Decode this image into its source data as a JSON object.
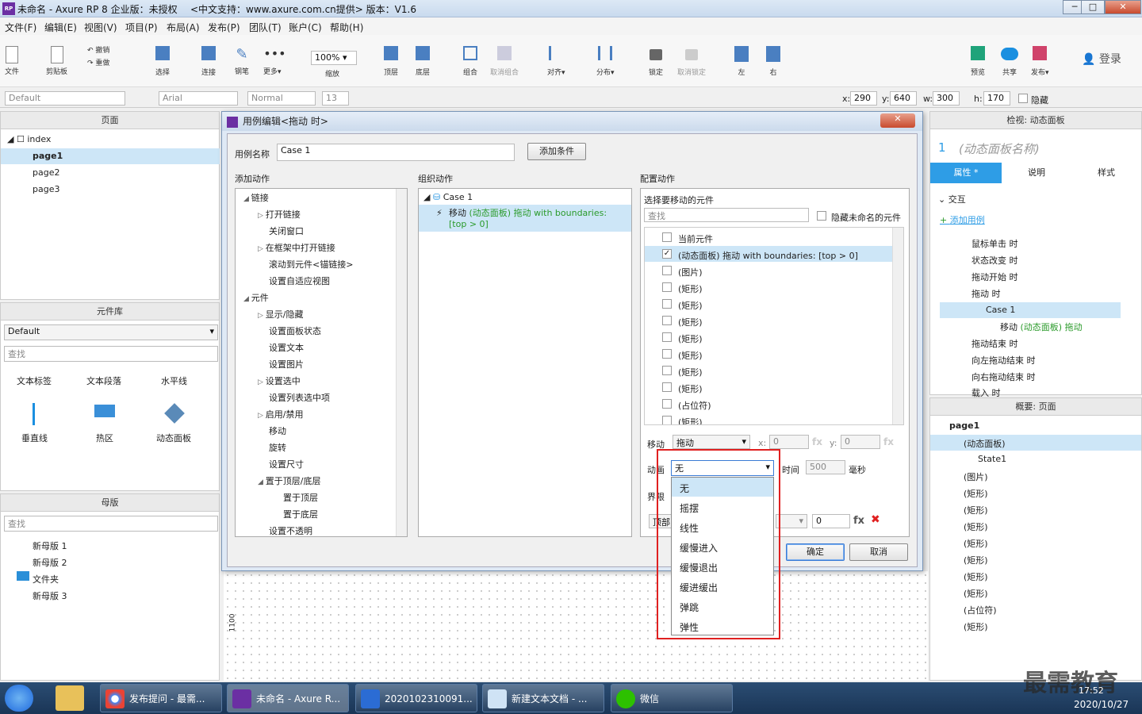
{
  "window": {
    "title": "未命名 - Axure RP 8 企业版：未授权",
    "support": "<中文支持：www.axure.com.cn提供> 版本：V1.6",
    "min": "─",
    "max": "□",
    "close": "✕"
  },
  "menu": [
    "文件(F)",
    "编辑(E)",
    "视图(V)",
    "项目(P)",
    "布局(A)",
    "发布(P)",
    "团队(T)",
    "账户(C)",
    "帮助(H)"
  ],
  "toolbar": {
    "file": "文件",
    "clipboard": "剪贴板",
    "undo": "撤销",
    "redo": "重做",
    "select": "选择",
    "connect": "连接",
    "pen": "钢笔",
    "more": "更多▾",
    "zoom": "100%",
    "zoom_label": "缩放",
    "top": "顶层",
    "bottom": "底层",
    "group": "组合",
    "ungroup": "取消组合",
    "align": "对齐▾",
    "distribute": "分布▾",
    "lock": "锁定",
    "unlock": "取消锁定",
    "left": "左",
    "right": "右",
    "preview": "预览",
    "share": "共享",
    "publish": "发布▾",
    "login": "登录"
  },
  "format": {
    "style": "Default",
    "font": "Arial",
    "weight": "Normal",
    "size": "13",
    "x_label": "x:",
    "x": "290",
    "y_label": "y:",
    "y": "640",
    "w_label": "w:",
    "w": "300",
    "h_label": "h:",
    "h": "170",
    "hidden": "隐藏"
  },
  "pages": {
    "title": "页面",
    "items": [
      "index",
      "page1",
      "page2",
      "page3"
    ]
  },
  "library": {
    "title": "元件库",
    "select": "Default",
    "search_placeholder": "查找",
    "widgets": [
      "文本标签",
      "文本段落",
      "水平线",
      "垂直线",
      "热区",
      "动态面板"
    ]
  },
  "masters": {
    "title": "母版",
    "search_placeholder": "查找",
    "items": [
      "新母版 1",
      "新母版 2",
      "文件夹",
      "新母版 3"
    ]
  },
  "dialog": {
    "title": "用例编辑<拖动 时>",
    "case_name_label": "用例名称",
    "case_name": "Case 1",
    "add_condition": "添加条件",
    "add_action": "添加动作",
    "organize": "组织动作",
    "configure": "配置动作",
    "actions": [
      {
        "t": "链接",
        "lvl": 0,
        "exp": "open"
      },
      {
        "t": "打开链接",
        "lvl": 1,
        "exp": "closed"
      },
      {
        "t": "关闭窗口",
        "lvl": 1
      },
      {
        "t": "在框架中打开链接",
        "lvl": 1,
        "exp": "closed"
      },
      {
        "t": "滚动到元件<锚链接>",
        "lvl": 1
      },
      {
        "t": "设置自适应视图",
        "lvl": 1
      },
      {
        "t": "元件",
        "lvl": 0,
        "exp": "open"
      },
      {
        "t": "显示/隐藏",
        "lvl": 1,
        "exp": "closed"
      },
      {
        "t": "设置面板状态",
        "lvl": 1
      },
      {
        "t": "设置文本",
        "lvl": 1
      },
      {
        "t": "设置图片",
        "lvl": 1
      },
      {
        "t": "设置选中",
        "lvl": 1,
        "exp": "closed"
      },
      {
        "t": "设置列表选中项",
        "lvl": 1
      },
      {
        "t": "启用/禁用",
        "lvl": 1,
        "exp": "closed"
      },
      {
        "t": "移动",
        "lvl": 1
      },
      {
        "t": "旋转",
        "lvl": 1
      },
      {
        "t": "设置尺寸",
        "lvl": 1
      },
      {
        "t": "置于顶层/底层",
        "lvl": 1,
        "exp": "open"
      },
      {
        "t": "置于顶层",
        "lvl": 2
      },
      {
        "t": "置于底层",
        "lvl": 2
      },
      {
        "t": "设置不透明",
        "lvl": 1
      }
    ],
    "org_case": "Case 1",
    "org_action": {
      "pre": "移动 ",
      "green": "(动态面板) 拖动 with boundaries:",
      "line2": "[top > 0]"
    },
    "select_widget": "选择要移动的元件",
    "filter_placeholder": "查找",
    "hide_unnamed": "隐藏未命名的元件",
    "widgets": [
      {
        "t": "当前元件",
        "checked": false
      },
      {
        "t": "(动态面板) 拖动 with boundaries: [top > 0]",
        "checked": true
      },
      {
        "t": "(图片)",
        "checked": false
      },
      {
        "t": "(矩形)",
        "checked": false
      },
      {
        "t": "(矩形)",
        "checked": false
      },
      {
        "t": "(矩形)",
        "checked": false
      },
      {
        "t": "(矩形)",
        "checked": false
      },
      {
        "t": "(矩形)",
        "checked": false
      },
      {
        "t": "(矩形)",
        "checked": false
      },
      {
        "t": "(矩形)",
        "checked": false
      },
      {
        "t": "(占位符)",
        "checked": false
      },
      {
        "t": "(矩形)",
        "checked": false
      }
    ],
    "move_label": "移动",
    "move_value": "拖动",
    "x_label": "x:",
    "x": "0",
    "y_label": "y:",
    "y": "0",
    "fx": "fx",
    "anim_label": "动画",
    "anim_value": "无",
    "time_label": "时间",
    "time": "500",
    "ms": "毫秒",
    "bound_label": "界限",
    "bound_value": "顶部",
    "bound_num": "0",
    "anim_options": [
      "无",
      "摇摆",
      "线性",
      "缓慢进入",
      "缓慢退出",
      "缓进缓出",
      "弹跳",
      "弹性"
    ],
    "ok": "确定",
    "cancel": "取消"
  },
  "inspector": {
    "title": "检视: 动态面板",
    "index": "1",
    "name_placeholder": "(动态面板名称)",
    "tabs": [
      "属性",
      "说明",
      "样式"
    ],
    "tab_mark": "*",
    "section": "交互",
    "add_case": "添加用例",
    "events": [
      "鼠标单击 时",
      "状态改变 时",
      "拖动开始 时",
      "拖动 时",
      "Case 1",
      "移动",
      "拖动结束 时",
      "向左拖动结束 时",
      "向右拖动结束 时",
      "载入 时"
    ],
    "move_green": "(动态面板) 拖动"
  },
  "outline": {
    "title": "概要: 页面",
    "items": [
      "page1",
      "(动态面板)",
      "State1",
      "(图片)",
      "(矩形)",
      "(矩形)",
      "(矩形)",
      "(矩形)",
      "(矩形)",
      "(矩形)",
      "(矩形)",
      "(占位符)",
      "(矩形)"
    ]
  },
  "canvas": {
    "ruler": "1100"
  },
  "taskbar": {
    "items": [
      "发布提问 - 最需...",
      "未命名 - Axure R...",
      "2020102310091...",
      "新建文本文档 - ...",
      "微信"
    ],
    "date": "2020/10/27",
    "time": "17:52",
    "watermark": "最需教育"
  },
  "colors": {
    "accent": "#2e9de6",
    "highlight": "#e02020",
    "green": "#2a9a2a"
  }
}
